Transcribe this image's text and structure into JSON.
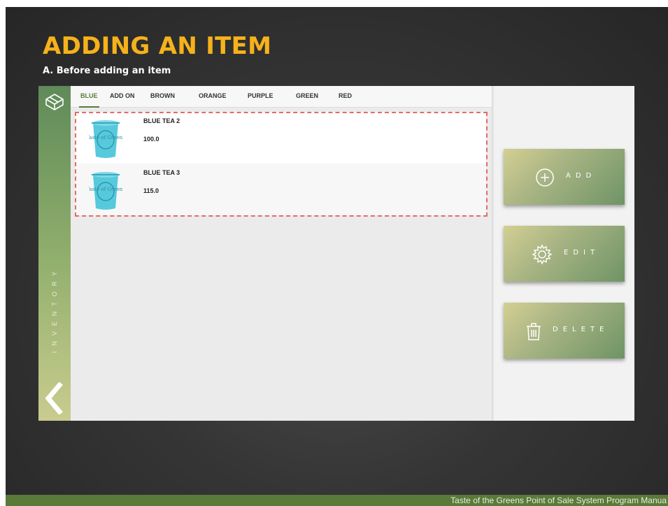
{
  "slide": {
    "title": "ADDING AN ITEM",
    "subtitle": "A. Before adding an item",
    "footer": "Taste of the Greens Point of Sale System Program Manua"
  },
  "sidebar": {
    "section_label": "INVENTORY",
    "logo_icon": "box-logo-icon",
    "back_icon": "chevron-left-icon"
  },
  "tabs": [
    {
      "label": "BLUE",
      "active": true
    },
    {
      "label": "ADD ON",
      "active": false
    },
    {
      "label": "BROWN",
      "active": false
    },
    {
      "label": "ORANGE",
      "active": false
    },
    {
      "label": "PURPLE",
      "active": false
    },
    {
      "label": "GREEN",
      "active": false
    },
    {
      "label": "RED",
      "active": false
    }
  ],
  "items": [
    {
      "name": "BLUE TEA 2",
      "price": "100.0",
      "image_icon": "tea-cup-image",
      "image_text": "Taste of Greens"
    },
    {
      "name": "BLUE TEA 3",
      "price": "115.0",
      "image_icon": "tea-cup-image",
      "image_text": "Taste of Greens"
    }
  ],
  "actions": {
    "add": {
      "label": "ADD",
      "icon": "plus-circle-icon"
    },
    "edit": {
      "label": "EDIT",
      "icon": "gear-icon"
    },
    "delete": {
      "label": "DELETE",
      "icon": "trash-icon"
    }
  },
  "colors": {
    "title": "#f6b21b",
    "accent_green": "#5a7a3a",
    "highlight_dash": "#e66a6a",
    "cup_blue": "#56c9dd"
  }
}
